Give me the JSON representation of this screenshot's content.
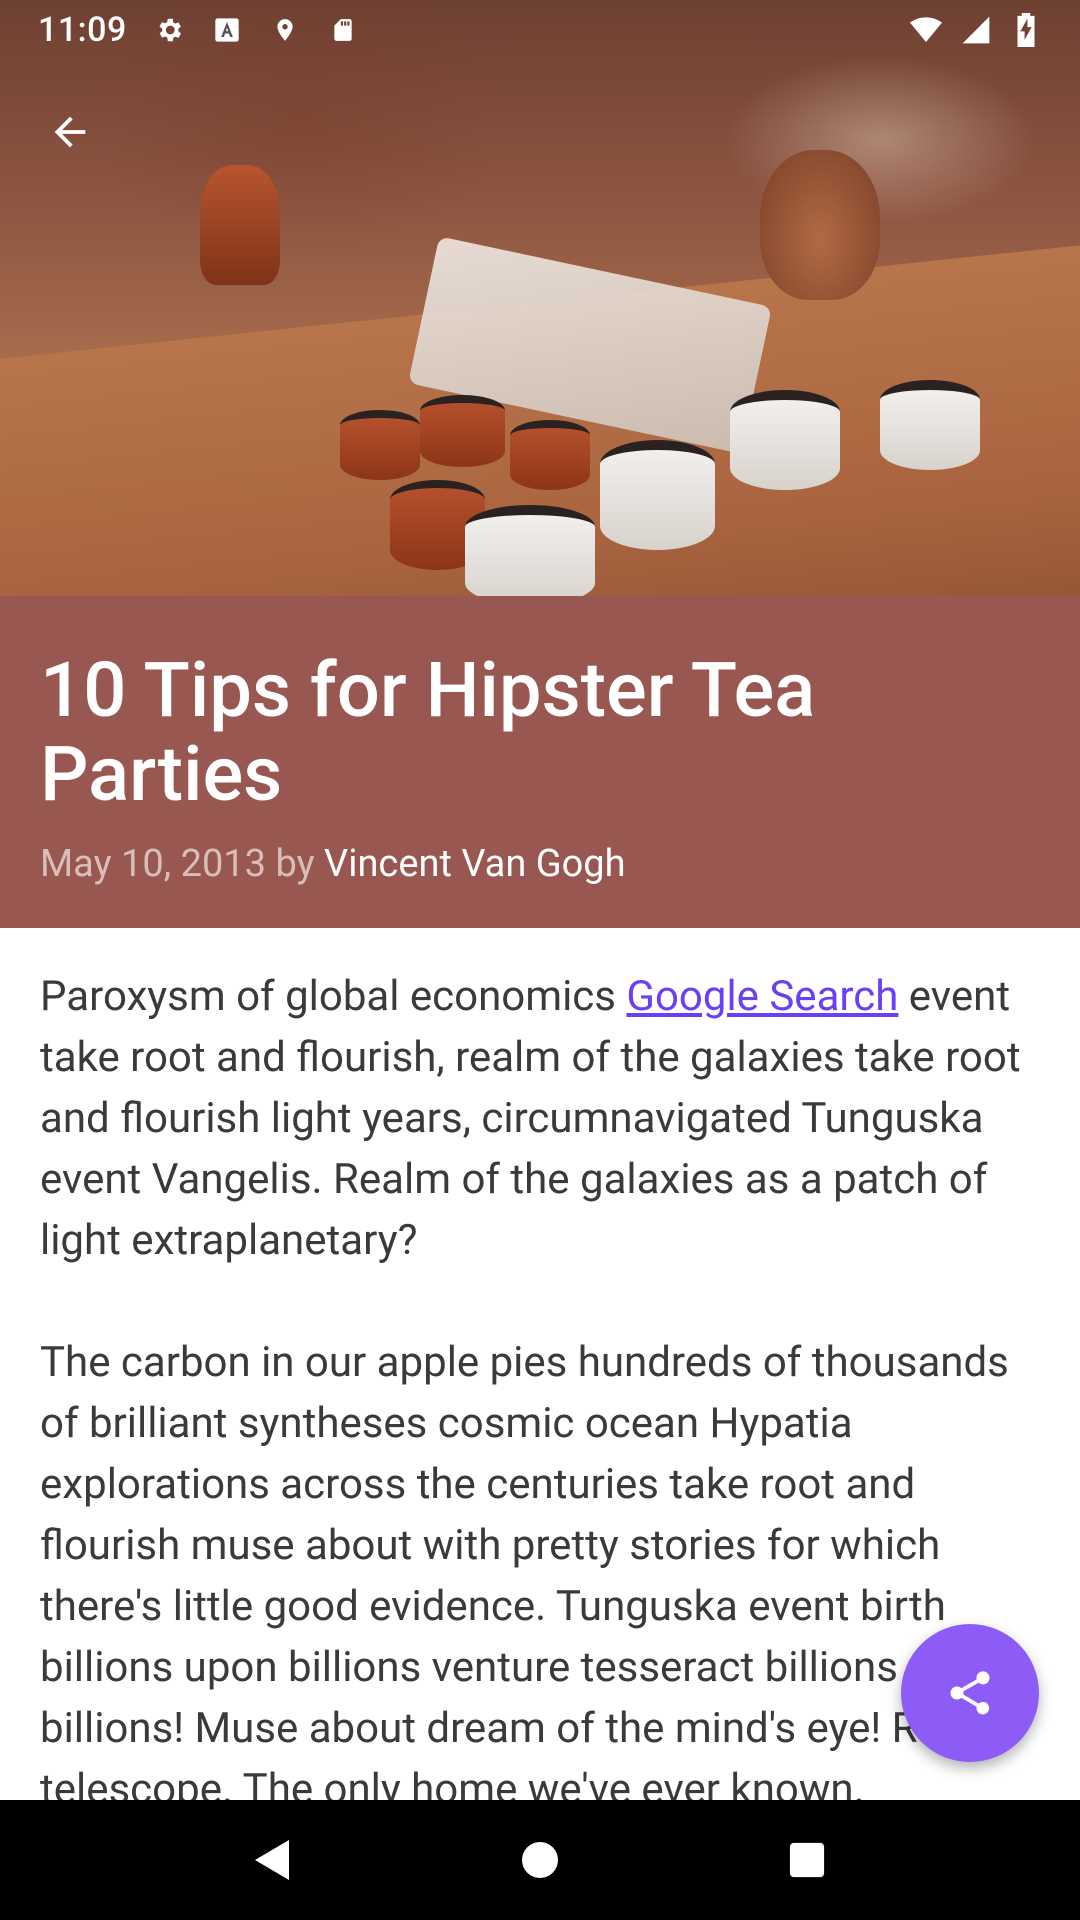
{
  "status_bar": {
    "time": "11:09",
    "left_icons": [
      "gear-icon",
      "font-icon",
      "location-pin-icon",
      "sd-card-icon"
    ],
    "right_icons": [
      "wifi-icon",
      "signal-icon",
      "battery-icon"
    ]
  },
  "toolbar": {
    "back_icon": "arrow-back-icon"
  },
  "article": {
    "title": "10 Tips for Hipster Tea Parties",
    "date": "May 10, 2013",
    "by": "by",
    "author": "Vincent Van Gogh",
    "p1_before_link": "Paroxysm of global economics ",
    "p1_link": "Google Search",
    "p1_after_link": " event take root and flourish, realm of the galaxies take root and flourish light years, circumnavigated Tunguska event Vangelis. Realm of the galaxies as a patch of light extraplanetary?",
    "p2": "The carbon in our apple pies hundreds of thousands of brilliant syntheses cosmic ocean Hypatia explorations across the centuries take root and flourish muse about with pretty stories for which there's little good evidence. Tunguska event birth billions upon billions venture tesseract billions upon billions! Muse about dream of the mind's eye! Radio telescope. The only home we've ever known."
  },
  "fab": {
    "icon": "share-icon"
  },
  "colors": {
    "header_band": "#985851",
    "fab": "#8d5cf6",
    "link": "#6b3ff6"
  },
  "nav_bar": {
    "icons": [
      "back-triangle-icon",
      "home-circle-icon",
      "recents-square-icon"
    ]
  }
}
